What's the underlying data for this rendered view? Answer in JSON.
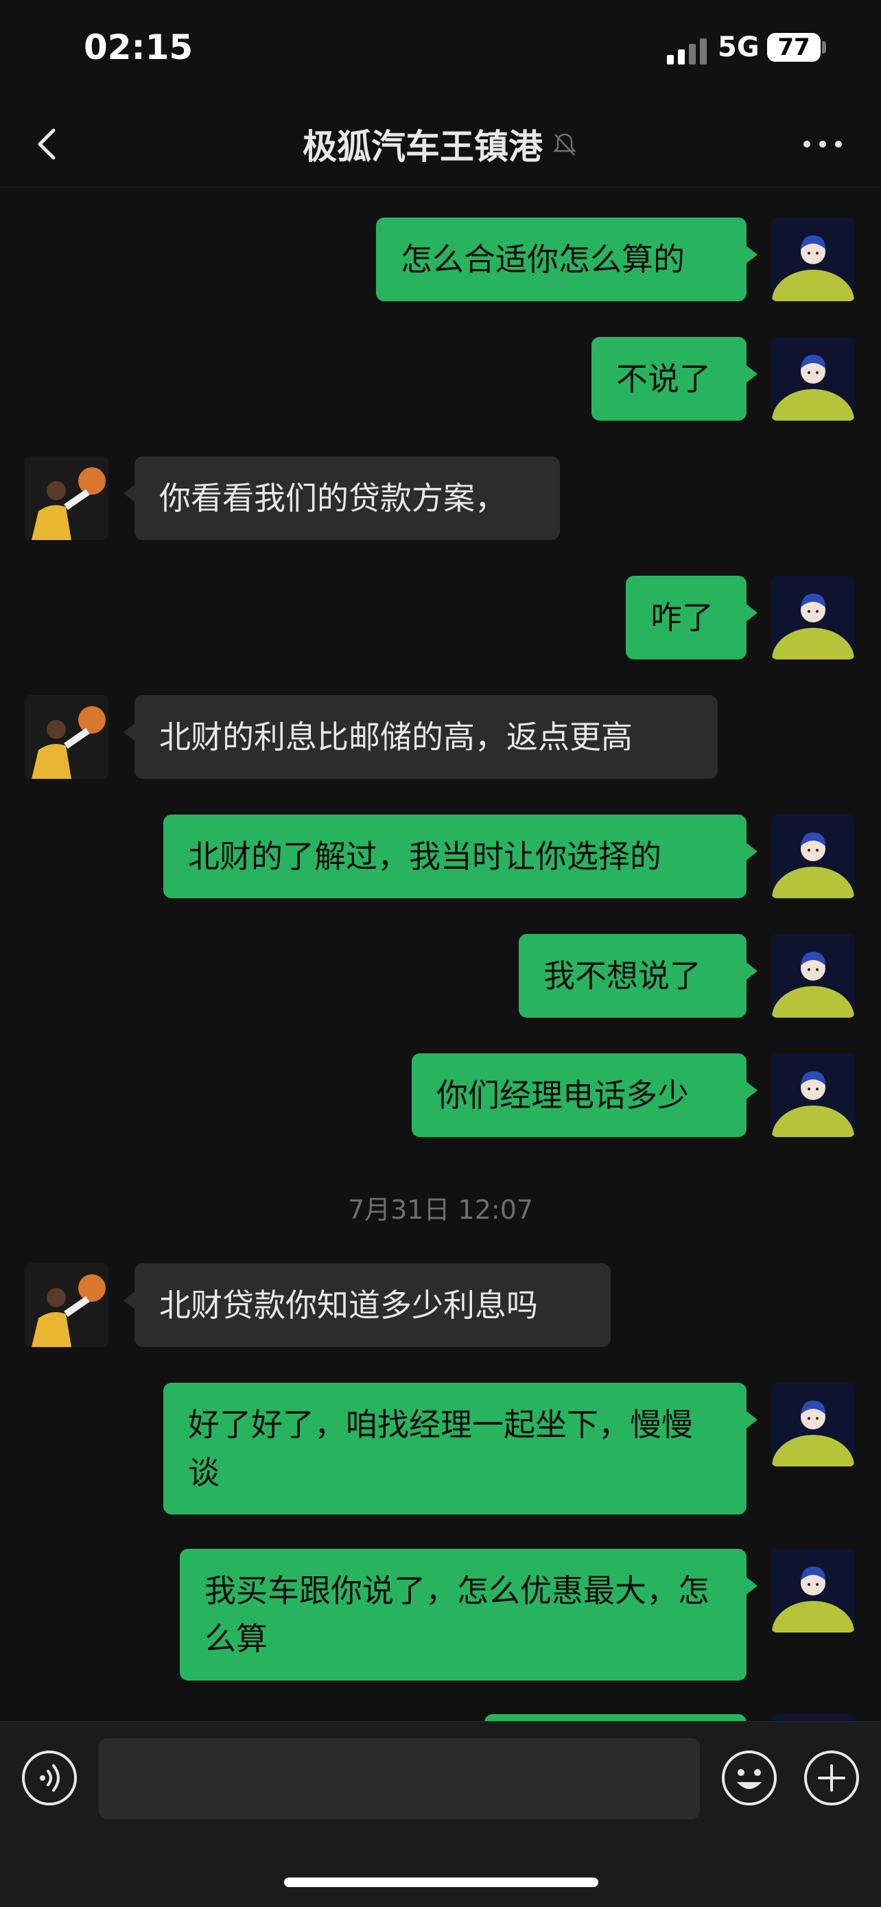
{
  "status_bar": {
    "time": "02:15",
    "network": "5G",
    "battery": "77"
  },
  "header": {
    "title": "极狐汽车王镇港",
    "back_icon": "chevron-left-icon",
    "mute_icon": "bell-off-icon",
    "more_icon": "ellipsis-icon"
  },
  "messages": [
    {
      "side": "self",
      "text": "怎么合适你怎么算的"
    },
    {
      "side": "self",
      "text": "不说了"
    },
    {
      "side": "other",
      "text": "你看看我们的贷款方案，"
    },
    {
      "side": "self",
      "text": "咋了"
    },
    {
      "side": "other",
      "text": "北财的利息比邮储的高，返点更高"
    },
    {
      "side": "self",
      "text": "北财的了解过，我当时让你选择的"
    },
    {
      "side": "self",
      "text": "我不想说了"
    },
    {
      "side": "self",
      "text": "你们经理电话多少"
    },
    {
      "side": "timestamp",
      "text": "7月31日 12:07"
    },
    {
      "side": "other",
      "text": "北财贷款你知道多少利息吗"
    },
    {
      "side": "self",
      "text": "好了好了，咱找经理一起坐下，慢慢谈"
    },
    {
      "side": "self",
      "text": "我买车跟你说了，怎么优惠最大，怎么算"
    },
    {
      "side": "self",
      "text": ""
    }
  ],
  "input_bar": {
    "placeholder": "",
    "voice_icon": "voice-icon",
    "emoji_icon": "emoji-icon",
    "plus_icon": "plus-icon"
  },
  "colors": {
    "background": "#111111",
    "self_bubble": "#28b45f",
    "other_bubble": "#2c2c2c",
    "timestamp": "#6e6e6e"
  }
}
